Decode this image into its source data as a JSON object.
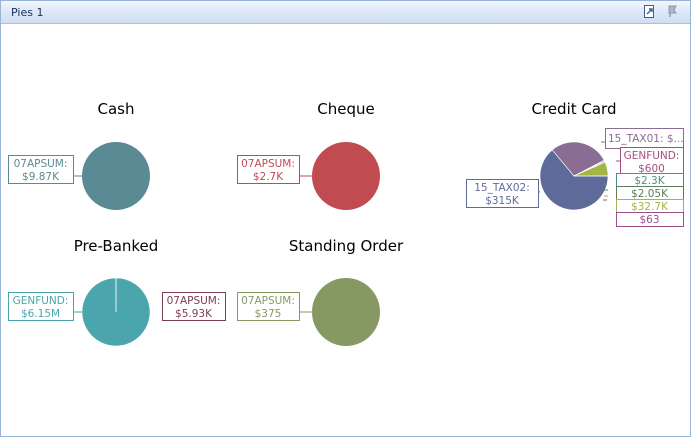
{
  "window": {
    "title": "Pies 1",
    "icons": [
      "export-icon",
      "pin-icon"
    ]
  },
  "chart_data": {
    "type": "pie",
    "pies": [
      {
        "title": "Cash",
        "slices": [
          {
            "name": "07APSUM",
            "label": "$9.87K",
            "value": 9870,
            "color": "#5a8a93"
          }
        ]
      },
      {
        "title": "Cheque",
        "slices": [
          {
            "name": "07APSUM",
            "label": "$2.7K",
            "value": 2700,
            "color": "#c04b51"
          }
        ]
      },
      {
        "title": "Credit Card",
        "slices": [
          {
            "name": "15_TAX02",
            "label": "$315K",
            "value": 315000,
            "color": "#5e6b9a"
          },
          {
            "name": "15_TAX01",
            "label": "$...",
            "value": 140000,
            "color": "#8a6d93"
          },
          {
            "name": "GENFUND",
            "label": "$600",
            "value": 600,
            "color": "#a64f7f"
          },
          {
            "name": "",
            "label": "$2.3K",
            "value": 2300,
            "color": "#4d8f86"
          },
          {
            "name": "",
            "label": "$2.05K",
            "value": 2050,
            "color": "#5e7d55"
          },
          {
            "name": "",
            "label": "$32.7K",
            "value": 32700,
            "color": "#a4b445"
          },
          {
            "name": "",
            "label": "$63",
            "value": 63,
            "color": "#9c4d8c"
          }
        ]
      },
      {
        "title": "Pre-Banked",
        "slices": [
          {
            "name": "GENFUND",
            "label": "$6.15M",
            "value": 6150000,
            "color": "#4aa5ad"
          },
          {
            "name": "07APSUM",
            "label": "$5.93K",
            "value": 5930,
            "color": "#7d3d55"
          }
        ]
      },
      {
        "title": "Standing Order",
        "slices": [
          {
            "name": "07APSUM",
            "label": "$375",
            "value": 375,
            "color": "#879963"
          }
        ]
      }
    ]
  }
}
